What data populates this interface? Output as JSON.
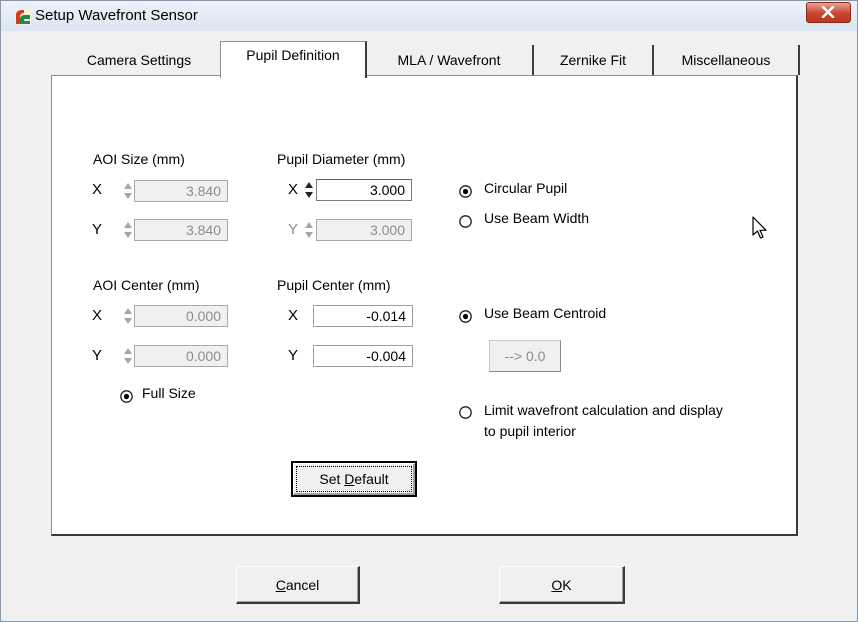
{
  "window": {
    "title": "Setup Wavefront Sensor",
    "icon": "app-logo-icon",
    "close_icon": "close-icon"
  },
  "tabs": [
    {
      "label": "Camera Settings",
      "active": false
    },
    {
      "label": "Pupil Definition",
      "active": true
    },
    {
      "label": "MLA / Wavefront",
      "active": false
    },
    {
      "label": "Zernike Fit",
      "active": false
    },
    {
      "label": "Miscellaneous",
      "active": false
    }
  ],
  "aoi_size": {
    "heading": "AOI Size (mm)",
    "x_label": "X",
    "y_label": "Y",
    "x_value": "3.840",
    "y_value": "3.840"
  },
  "pupil_diameter": {
    "heading": "Pupil Diameter (mm)",
    "x_label": "X",
    "y_label": "Y",
    "x_value": "3.000",
    "y_value": "3.000"
  },
  "aoi_center": {
    "heading": "AOI Center (mm)",
    "x_label": "X",
    "y_label": "Y",
    "x_value": "0.000",
    "y_value": "0.000"
  },
  "pupil_center": {
    "heading": "Pupil Center (mm)",
    "x_label": "X",
    "y_label": "Y",
    "x_value": "-0.014",
    "y_value": "-0.004"
  },
  "options": {
    "circular_pupil": "Circular Pupil",
    "use_beam_width": "Use Beam Width",
    "use_beam_centroid": "Use Beam Centroid",
    "reset_center": "--> 0.0",
    "full_size": "Full Size",
    "limit_line1": "Limit wavefront calculation and display",
    "limit_line2": "to pupil interior"
  },
  "buttons": {
    "set_default_pre": "Set ",
    "set_default_acc": "D",
    "set_default_post": "efault",
    "cancel_acc": "C",
    "cancel_post": "ancel",
    "ok_acc": "O",
    "ok_post": "K"
  },
  "colors": {
    "title_gradient_top": "#eef3fa",
    "close_button_red": "#c9452f",
    "panel_background": "#ffffff",
    "disabled_text": "#8c8c8c"
  }
}
